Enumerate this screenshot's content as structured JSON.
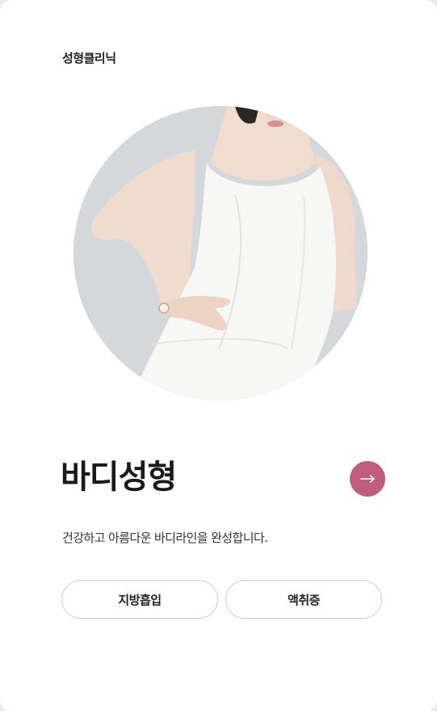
{
  "header": {
    "category_label": "성형클리닉"
  },
  "hero": {
    "image_alt": "Woman in white sleeveless dress with hand on hip"
  },
  "section": {
    "title": "바디성형",
    "description": "건강하고 아름다운 바디라인을 완성합니다.",
    "arrow_icon": "arrow-right-icon"
  },
  "buttons": [
    {
      "label": "지방흡입"
    },
    {
      "label": "액취증"
    }
  ],
  "colors": {
    "accent": "#bf5d7e",
    "background": "#ffffff"
  }
}
